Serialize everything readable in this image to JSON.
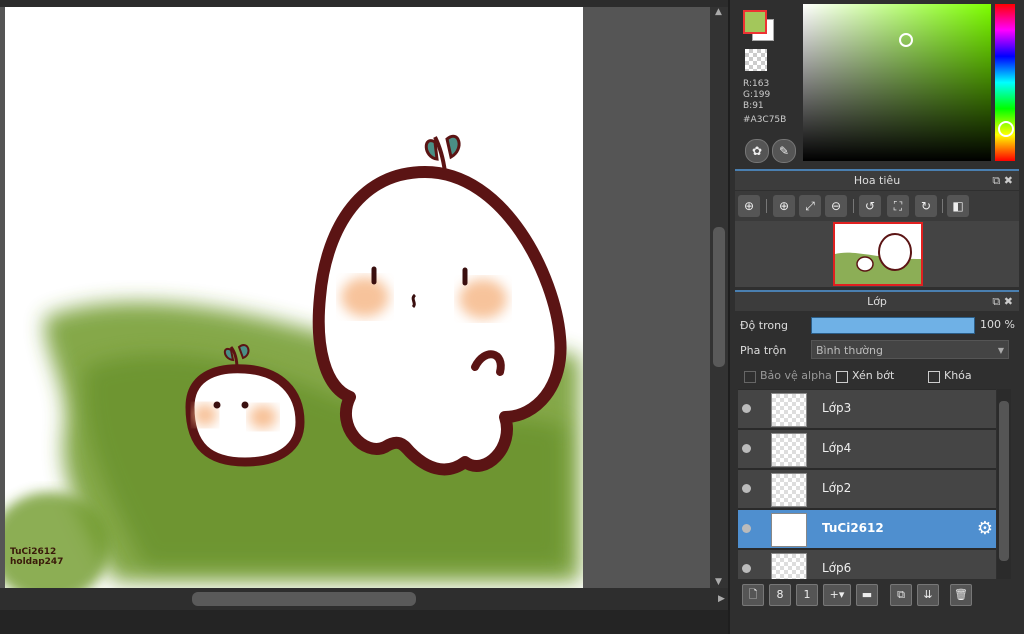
{
  "color": {
    "foreground": "#A3C75B",
    "r_label": "R:163",
    "g_label": "G:199",
    "b_label": "B:91",
    "hex_label": "#A3C75B",
    "palette_icon": "palette-icon",
    "eyedropper_palette_icon": "palette-picker-icon"
  },
  "navigator": {
    "title": "Hoa tiêu",
    "tools": [
      "zoom-fit-icon",
      "zoom-in-icon",
      "fit-window-icon",
      "zoom-out-icon",
      "rotate-left-icon",
      "actual-size-icon",
      "rotate-right-icon",
      "flip-icon"
    ]
  },
  "layers_panel": {
    "title": "Lớp",
    "opacity_label": "Độ trong",
    "opacity_value": "100 %",
    "opacity_fraction": 1.0,
    "blend_label": "Pha trộn",
    "blend_value": "Bình thường",
    "protect_alpha": "Bảo vệ alpha",
    "clipping": "Xén bớt",
    "lock": "Khóa",
    "layers": [
      {
        "name": "Lớp3",
        "selected": false
      },
      {
        "name": "Lớp4",
        "selected": false
      },
      {
        "name": "Lớp2",
        "selected": false
      },
      {
        "name": "TuCi2612",
        "selected": true
      },
      {
        "name": "Lớp6",
        "selected": false
      }
    ]
  },
  "canvas": {
    "watermark_line1": "TuCi2612",
    "watermark_line2": "holdap247"
  }
}
